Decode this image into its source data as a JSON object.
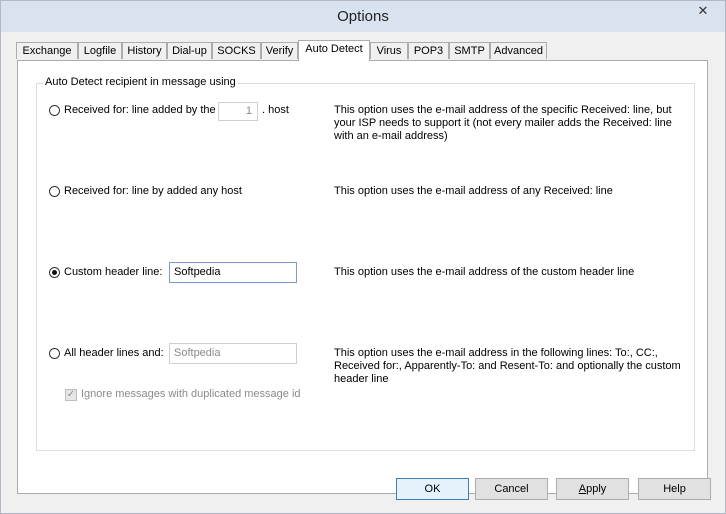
{
  "window": {
    "title": "Options",
    "close_glyph": "✕"
  },
  "tabs": [
    {
      "label": "Exchange",
      "active": false
    },
    {
      "label": "Logfile",
      "active": false
    },
    {
      "label": "History",
      "active": false
    },
    {
      "label": "Dial-up",
      "active": false
    },
    {
      "label": "SOCKS",
      "active": false
    },
    {
      "label": "Verify",
      "active": false
    },
    {
      "label": "Auto Detect",
      "active": true
    },
    {
      "label": "Virus",
      "active": false
    },
    {
      "label": "POP3",
      "active": false
    },
    {
      "label": "SMTP",
      "active": false
    },
    {
      "label": "Advanced",
      "active": false
    }
  ],
  "group": {
    "caption": "Auto Detect recipient in message using"
  },
  "options": {
    "received_for_line": {
      "label": "Received for: line added by the",
      "spin_value": "1",
      "suffix": ". host",
      "checked": false,
      "description": "This option uses the e-mail address of the specific Received: line, but your ISP needs to support it (not every mailer adds the Received: line with an e-mail address)"
    },
    "received_any": {
      "label": "Received for: line by added any host",
      "checked": false,
      "description": "This option uses the e-mail address of any Received: line"
    },
    "custom_header": {
      "label": "Custom header line:",
      "value": "Softpedia",
      "checked": true,
      "description": "This option uses the e-mail address of the custom header line"
    },
    "all_headers": {
      "label": "All header lines and:",
      "value": "Softpedia",
      "checked": false,
      "description": "This option uses the e-mail address in the following lines: To:, CC:, Received for:, Apparently-To: and Resent-To: and optionally the custom header line"
    },
    "ignore_duplicates": {
      "label": "Ignore messages with duplicated message id",
      "checked": true,
      "disabled": true
    }
  },
  "buttons": {
    "ok": "OK",
    "cancel": "Cancel",
    "apply_prefix": "",
    "apply_ul": "A",
    "apply_rest": "pply",
    "help": "Help"
  },
  "colors": {
    "accent": "#3c7fb1",
    "titlebar": "#d9e3f0"
  }
}
